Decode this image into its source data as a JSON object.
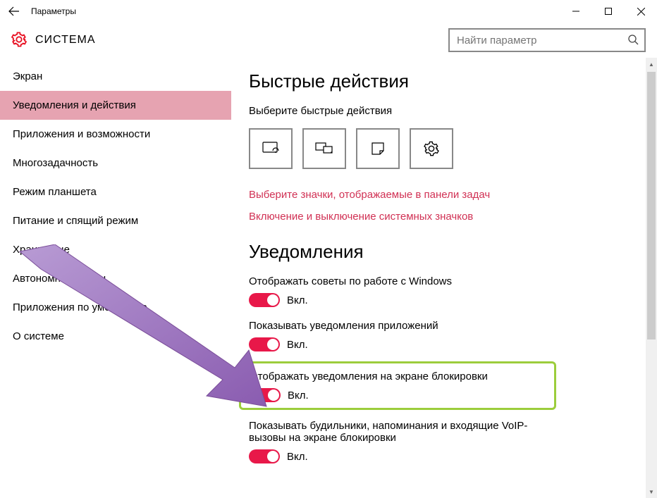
{
  "titlebar": {
    "title": "Параметры"
  },
  "header": {
    "title": "СИСТЕМА",
    "search_placeholder": "Найти параметр"
  },
  "sidebar": {
    "items": [
      {
        "label": "Экран",
        "selected": false
      },
      {
        "label": "Уведомления и действия",
        "selected": true
      },
      {
        "label": "Приложения и возможности",
        "selected": false
      },
      {
        "label": "Многозадачность",
        "selected": false
      },
      {
        "label": "Режим планшета",
        "selected": false
      },
      {
        "label": "Питание и спящий режим",
        "selected": false
      },
      {
        "label": "Хранилище",
        "selected": false
      },
      {
        "label": "Автономные карты",
        "selected": false
      },
      {
        "label": "Приложения по умолчанию",
        "selected": false
      },
      {
        "label": "О системе",
        "selected": false
      }
    ]
  },
  "content": {
    "quick_heading": "Быстрые действия",
    "quick_sub": "Выберите быстрые действия",
    "quick_tiles": [
      {
        "icon": "tablet-icon"
      },
      {
        "icon": "project-icon"
      },
      {
        "icon": "note-icon"
      },
      {
        "icon": "settings-icon"
      }
    ],
    "link1": "Выберите значки, отображаемые в панели задач",
    "link2": "Включение и выключение системных значков",
    "notif_heading": "Уведомления",
    "settings": [
      {
        "label": "Отображать советы по работе с Windows",
        "state": "Вкл.",
        "on": true,
        "highlight": false
      },
      {
        "label": "Показывать уведомления приложений",
        "state": "Вкл.",
        "on": true,
        "highlight": false
      },
      {
        "label": "Отображать уведомления на экране блокировки",
        "state": "Вкл.",
        "on": true,
        "highlight": true
      },
      {
        "label": "Показывать будильники, напоминания и входящие VoIP-вызовы на экране блокировки",
        "state": "Вкл.",
        "on": true,
        "highlight": false
      }
    ]
  },
  "colors": {
    "accent": "#e81849",
    "link": "#d13154",
    "highlight_border": "#9ccd3c",
    "arrow": "#9b70c2",
    "selected_bg": "#e6a3b1"
  }
}
